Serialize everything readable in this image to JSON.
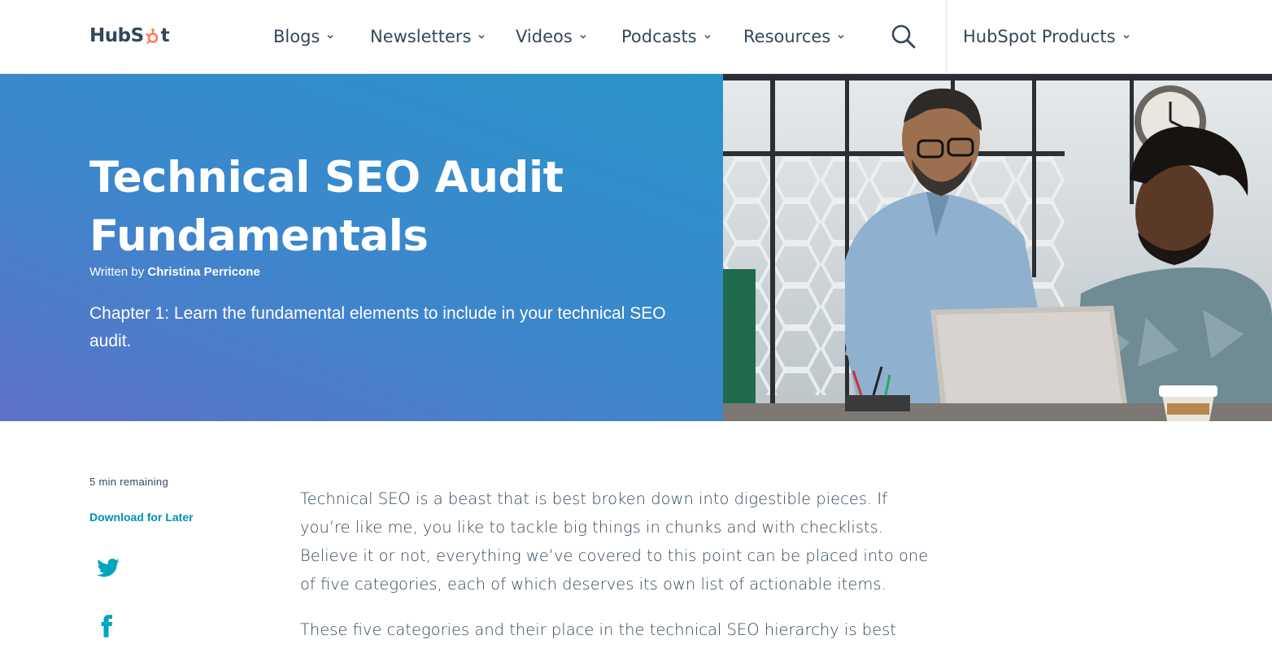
{
  "header": {
    "logo_text_a": "HubS",
    "logo_text_b": "t",
    "nav": [
      {
        "label": "Blogs"
      },
      {
        "label": "Newsletters"
      },
      {
        "label": "Videos"
      },
      {
        "label": "Podcasts"
      },
      {
        "label": "Resources"
      }
    ],
    "products_label": "HubSpot Products",
    "icons": {
      "search": "search-icon",
      "chevron": "chevron-down-icon",
      "logo": "sprocket-icon"
    }
  },
  "hero": {
    "title_line1": "Technical SEO Audit",
    "title_line2": "Fundamentals",
    "byline_prefix": "Written by ",
    "author": "Christina Perricone",
    "chapter": "Chapter 1: Learn the fundamental elements to include in your technical SEO audit."
  },
  "sidebar": {
    "remaining": "5 min remaining",
    "download": "Download for Later",
    "share_icons": [
      "twitter-icon",
      "facebook-icon"
    ]
  },
  "article": {
    "paragraphs": [
      "Technical SEO is a beast that is best broken down into digestible pieces. If you’re like me, you like to tackle big things in chunks and with checklists. Believe it or not, everything we’ve covered to this point can be placed into one of five categories, each of which deserves its own list of actionable items.",
      "These five categories and their place in the technical SEO hierarchy is best"
    ]
  },
  "colors": {
    "text": "#33475b",
    "accent_orange": "#ff7a59",
    "link_teal": "#0091ae",
    "hero_gradient_start": "#5f72c8",
    "hero_gradient_end": "#2a94ca",
    "social_teal": "#00a4bd"
  }
}
